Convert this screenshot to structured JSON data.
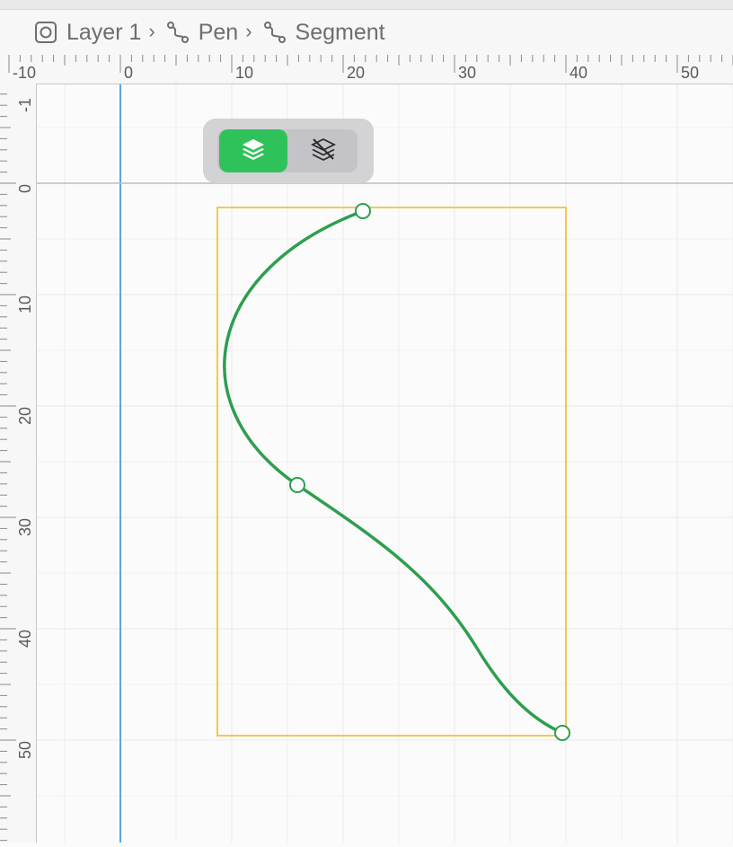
{
  "breadcrumb": {
    "items": [
      {
        "label": "Layer 1",
        "icon": "layer-frame-icon"
      },
      {
        "label": "Pen",
        "icon": "pen-path-icon"
      },
      {
        "label": "Segment",
        "icon": "segment-path-icon"
      }
    ],
    "separator": "›"
  },
  "rulers": {
    "horizontal_labels": [
      "-10",
      "0",
      "10",
      "20",
      "30",
      "40",
      "50"
    ],
    "vertical_labels": [
      "-1",
      "0",
      "10",
      "20",
      "30",
      "40",
      "50"
    ]
  },
  "toolbar": {
    "layers_button_icon": "layers-icon",
    "hide_layers_button_icon": "layers-off-icon",
    "active_button": "layers"
  },
  "colors": {
    "accent_green": "#30c25a",
    "path_stroke": "#2e9e4f",
    "selection_box": "#f2c94c",
    "guide_vertical": "#5ba4e6",
    "guide_horizontal": "#bdbdc2",
    "grid": "#ececee"
  }
}
